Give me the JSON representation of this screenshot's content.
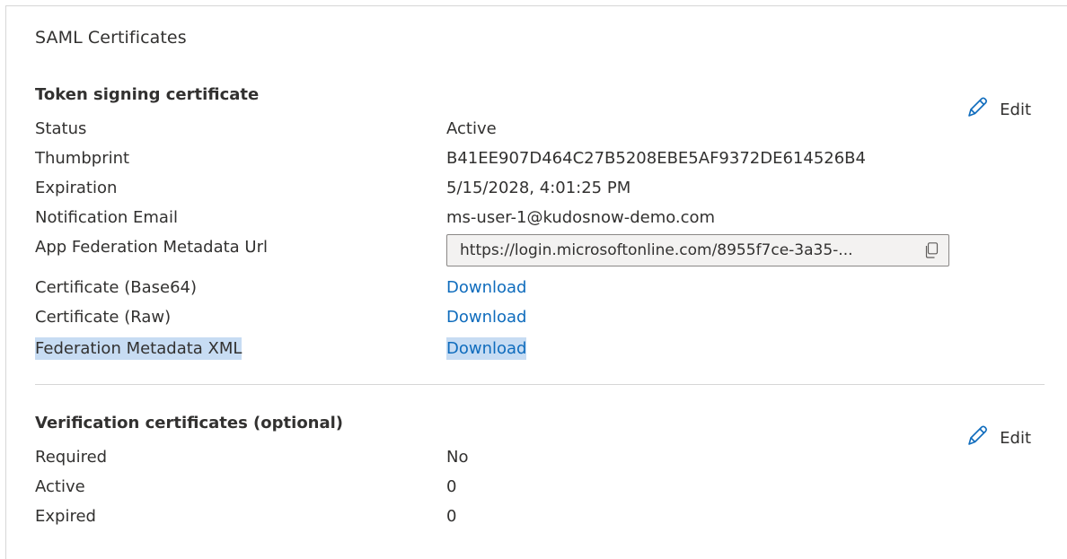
{
  "title": "SAML Certificates",
  "token_signing": {
    "heading": "Token signing certificate",
    "edit_label": "Edit",
    "rows": [
      {
        "label": "Status",
        "value": "Active"
      },
      {
        "label": "Thumbprint",
        "value": "B41EE907D464C27B5208EBE5AF9372DE614526B4"
      },
      {
        "label": "Expiration",
        "value": "5/15/2028, 4:01:25 PM"
      },
      {
        "label": "Notification Email",
        "value": "ms-user-1@kudosnow-demo.com"
      }
    ],
    "metadata_url": {
      "label": "App Federation Metadata Url",
      "value": "https://login.microsoftonline.com/8955f7ce-3a35-..."
    },
    "downloads": [
      {
        "label": "Certificate (Base64)",
        "link": "Download"
      },
      {
        "label": "Certificate (Raw)",
        "link": "Download"
      },
      {
        "label": "Federation Metadata XML",
        "link": "Download"
      }
    ]
  },
  "verification": {
    "heading": "Verification certificates (optional)",
    "edit_label": "Edit",
    "rows": [
      {
        "label": "Required",
        "value": "No"
      },
      {
        "label": "Active",
        "value": "0"
      },
      {
        "label": "Expired",
        "value": "0"
      }
    ]
  },
  "icons": {
    "edit": "pencil-icon",
    "copy": "copy-icon"
  },
  "colors": {
    "link": "#0f6cbd",
    "highlight": "#c7dcf3",
    "text": "#323130"
  }
}
